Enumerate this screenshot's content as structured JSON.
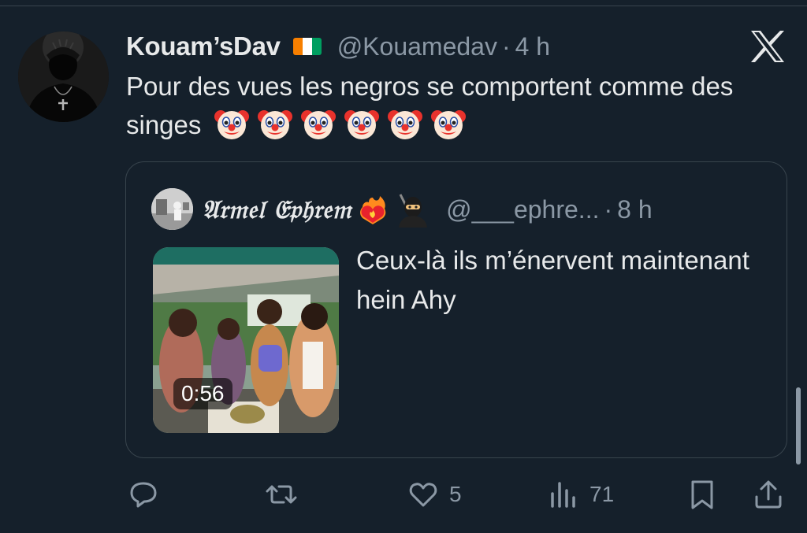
{
  "tweet": {
    "display_name": "Kouam’sDav",
    "handle": "@Kouamedav",
    "separator": "·",
    "time": "4 h",
    "text": "Pour des vues les negros se comportent comme des singes",
    "emoji_count": 6,
    "emoji_icon": "clown-face-icon",
    "flag_icon": "ivory-coast-flag-icon",
    "flag_colors": [
      "#f77f00",
      "#ffffff",
      "#009e60"
    ]
  },
  "quote": {
    "display_name": "𝔄𝔯𝔪𝔢𝔩 𝔈𝔭𝔥𝔯𝔢𝔪",
    "handle": "@___ephre...",
    "separator": "·",
    "time": "8 h",
    "text": "Ceux-là ils m’énervent maintenant hein Ahy",
    "name_icons": [
      "heart-on-fire-icon",
      "ninja-icon"
    ],
    "media": {
      "type": "video",
      "duration": "0:56"
    }
  },
  "actions": {
    "reply": {
      "icon": "reply-icon",
      "count": ""
    },
    "repost": {
      "icon": "repost-icon",
      "count": ""
    },
    "like": {
      "icon": "heart-icon",
      "count": "5"
    },
    "views": {
      "icon": "views-icon",
      "count": "71"
    },
    "bookmark": {
      "icon": "bookmark-icon",
      "count": ""
    },
    "share": {
      "icon": "share-icon",
      "count": ""
    }
  },
  "colors": {
    "background": "#15202b",
    "text_primary": "#e7e9ea",
    "text_secondary": "#8b98a5",
    "border": "#38444d"
  }
}
